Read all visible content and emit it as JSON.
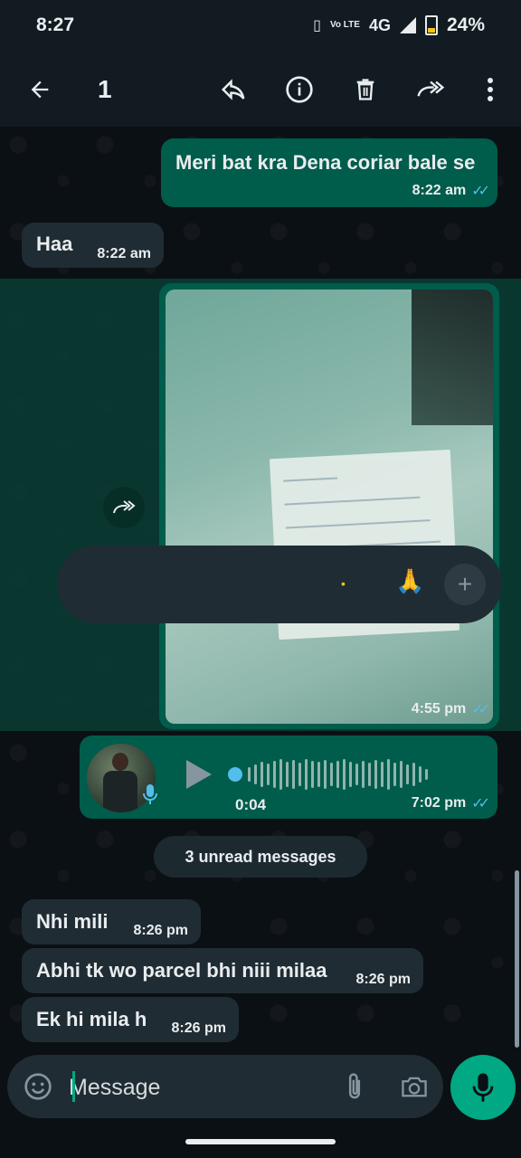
{
  "status_bar": {
    "time": "8:27",
    "network": "4G",
    "battery": "24%",
    "lte_label": "Vo LTE"
  },
  "action_bar": {
    "selected_count": "1"
  },
  "messages": [
    {
      "dir": "out",
      "text": "Meri bat kra Dena coriar bale se",
      "time": "8:22 am"
    },
    {
      "dir": "in",
      "text": "Haa",
      "time": "8:22 am"
    },
    {
      "dir": "out",
      "type": "image",
      "time": "4:55 pm"
    },
    {
      "dir": "out",
      "type": "voice",
      "duration": "0:04",
      "time": "7:02 pm"
    },
    {
      "dir": "in",
      "text": "Nhi mili",
      "time": "8:26 pm"
    },
    {
      "dir": "in",
      "text": "Abhi tk wo parcel bhi niii milaa",
      "time": "8:26 pm"
    },
    {
      "dir": "in",
      "text": "Ek hi mila h",
      "time": "8:26 pm"
    }
  ],
  "reactions": [
    "•",
    "🙏",
    "+"
  ],
  "unread_label": "3 unread messages",
  "composer": {
    "placeholder": "Message"
  },
  "colors": {
    "outgoing": "#005c4b",
    "incoming": "#202c33",
    "accent": "#00a884",
    "ticks": "#53bdeb"
  }
}
